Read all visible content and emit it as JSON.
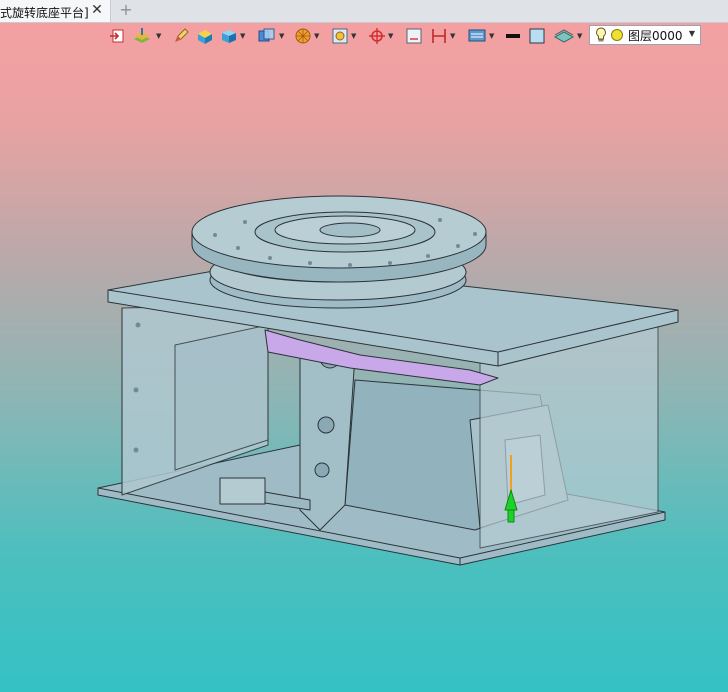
{
  "tab": {
    "title": "式旋转底座平台]",
    "close_glyph": "✕",
    "new_glyph": "+"
  },
  "toolbar": {
    "icons": [
      "exit-icon",
      "layer-stack-icon",
      "pencil-icon",
      "block-icon",
      "box-icon",
      "render-mode-icon",
      "sphere-color-icon",
      "zoom-frame-icon",
      "target-icon",
      "sketch-frame-icon",
      "dimension-icon",
      "display-settings-icon",
      "line-style-icon",
      "fill-color-icon",
      "layer-plane-icon"
    ],
    "layer_select": {
      "value": "图层0000",
      "light_icon": "bulb-icon",
      "color_icon": "yellow-dot-icon"
    }
  },
  "colors": {
    "background_top": "#f7a0a2",
    "background_bottom": "#34c2c4",
    "model_fill": "#a9c3cc",
    "model_edge": "#2b3338",
    "accent_purple": "#c8a8e8",
    "axis_green": "#1bd12a",
    "axis_orange": "#f0a020"
  }
}
